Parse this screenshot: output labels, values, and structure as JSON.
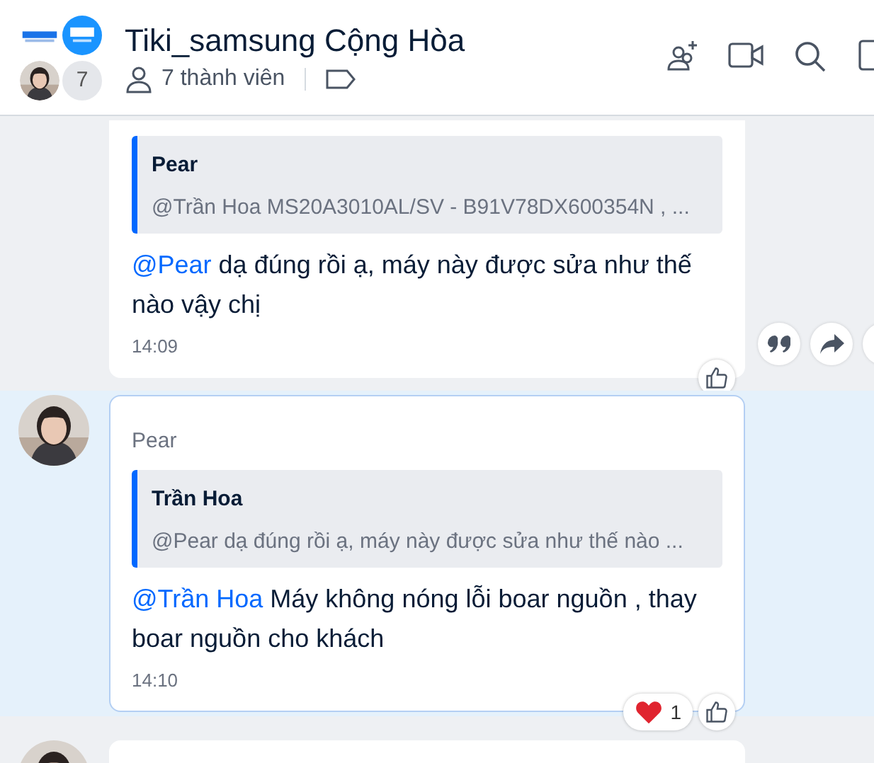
{
  "header": {
    "title": "Tiki_samsung Cộng Hòa",
    "member_count": "7",
    "members_label": "7 thành viên"
  },
  "messages": [
    {
      "kind": "full",
      "highlighted": false,
      "avatar": false,
      "show_actions": true,
      "quote": {
        "author": "Pear",
        "text": "@Trần Hoa MS20A3010AL/SV - B91V78DX600354N , ..."
      },
      "mention": "@Pear",
      "text": "dạ đúng rồi ạ, máy này được sửa như thế nào vậy chị",
      "time": "14:09"
    },
    {
      "kind": "full",
      "highlighted": true,
      "avatar": true,
      "show_actions": false,
      "sender": "Pear",
      "quote": {
        "author": "Trần Hoa",
        "text": "@Pear dạ đúng rồi ạ, máy này được sửa như thế nào ..."
      },
      "mention": "@Trần Hoa",
      "text": "Máy không nóng lỗi boar nguồn , thay boar nguồn cho khách",
      "time": "14:10",
      "reactions": [
        {
          "kind": "heart",
          "count": "1"
        }
      ]
    },
    {
      "kind": "partial",
      "highlighted": false,
      "avatar": true
    }
  ]
}
